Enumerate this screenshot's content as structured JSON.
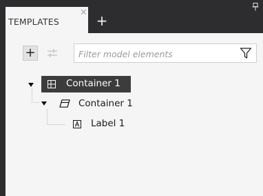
{
  "tabs": [
    {
      "label": "TEMPLATES",
      "close_icon": "close-icon",
      "active": true
    }
  ],
  "new_tab_label": "+",
  "toolbar": {
    "add_label": "+",
    "add_icon": "plus-icon",
    "toggle_icon": "filter-toggle-icon",
    "filter_placeholder": "Filter model elements",
    "filter_value": "",
    "filter_icon": "funnel-icon"
  },
  "tree": {
    "items": [
      {
        "label": "Container 1",
        "icon": "grid-container-icon",
        "expanded": true,
        "selected": true
      },
      {
        "label": "Container 1",
        "icon": "box-container-icon",
        "expanded": true,
        "selected": false
      },
      {
        "label": "Label 1",
        "icon": "label-icon",
        "selected": false
      }
    ]
  },
  "colors": {
    "chrome": "#2d2d30",
    "panel": "#f5f5f5",
    "selection": "#3c3c3c",
    "text": "#1a1a1a"
  }
}
